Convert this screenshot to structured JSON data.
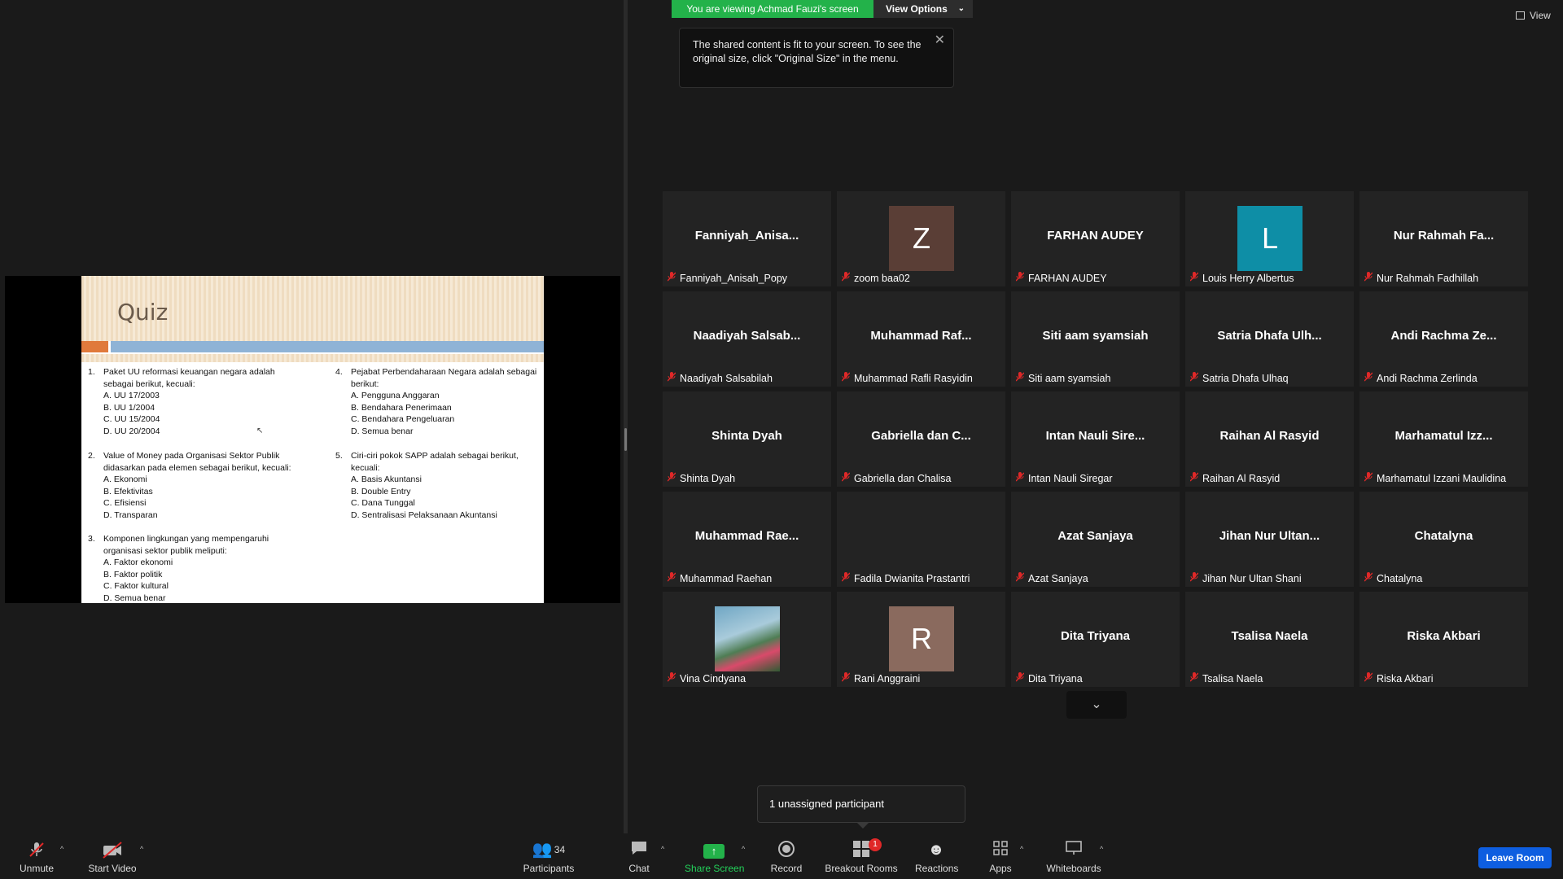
{
  "banner": {
    "viewing_text": "You are viewing Achmad Fauzi's screen",
    "view_options_label": "View Options"
  },
  "tooltip": {
    "text_line1": "The shared content is fit to your screen. To see the",
    "text_line2": "original size, click \"Original Size\" in the menu."
  },
  "top_right": {
    "view_label": "View"
  },
  "slide": {
    "title": "Quiz",
    "questions": [
      {
        "num": "1.",
        "lines": [
          "Paket UU reformasi keuangan negara adalah",
          "sebagai berikut, kecuali:",
          "A. UU 17/2003",
          "B. UU 1/2004",
          "C. UU 15/2004",
          "D. UU 20/2004"
        ]
      },
      {
        "num": "2.",
        "lines": [
          "Value of Money pada Organisasi Sektor Publik",
          "didasarkan pada elemen sebagai berikut, kecuali:",
          "A. Ekonomi",
          "B. Efektivitas",
          "C. Efisiensi",
          "D. Transparan"
        ]
      },
      {
        "num": "3.",
        "lines": [
          "Komponen lingkungan yang mempengaruhi",
          "organisasi sektor publik meliputi:",
          "A. Faktor ekonomi",
          "B. Faktor politik",
          "C. Faktor kultural",
          "D. Semua benar"
        ]
      },
      {
        "num": "4.",
        "lines": [
          "Pejabat Perbendaharaan Negara adalah sebagai",
          "berikut:",
          "A. Pengguna Anggaran",
          "B. Bendahara Penerimaan",
          "C. Bendahara Pengeluaran",
          "D. Semua benar"
        ]
      },
      {
        "num": "5.",
        "lines": [
          "Ciri-ciri pokok SAPP adalah sebagai berikut,",
          "kecuali:",
          "A. Basis Akuntansi",
          "B. Double Entry",
          "C. Dana Tunggal",
          "D. Sentralisasi Pelaksanaan Akuntansi"
        ]
      }
    ]
  },
  "participants": [
    {
      "display": "Fanniyah_Anisa...",
      "name": "Fanniyah_Anisah_Popy"
    },
    {
      "display": "",
      "name": "zoom baa02",
      "avatar_letter": "Z",
      "avatar_color": "#5a3e36"
    },
    {
      "display": "FARHAN AUDEY",
      "name": "FARHAN AUDEY"
    },
    {
      "display": "",
      "name": "Louis Herry Albertus",
      "avatar_letter": "L",
      "avatar_color": "#0e8ea6"
    },
    {
      "display": "Nur Rahmah Fa...",
      "name": "Nur Rahmah Fadhillah"
    },
    {
      "display": "Naadiyah  Salsab...",
      "name": "Naadiyah Salsabilah"
    },
    {
      "display": "Muhammad  Raf...",
      "name": "Muhammad Rafli Rasyidin"
    },
    {
      "display": "Siti aam syamsiah",
      "name": "Siti aam syamsiah"
    },
    {
      "display": "Satria  Dhafa  Ulh...",
      "name": "Satria Dhafa Ulhaq"
    },
    {
      "display": "Andi  Rachma  Ze...",
      "name": "Andi Rachma Zerlinda"
    },
    {
      "display": "Shinta Dyah",
      "name": "Shinta Dyah"
    },
    {
      "display": "Gabriella  dan  C...",
      "name": "Gabriella dan Chalisa"
    },
    {
      "display": "Intan  Nauli  Sire...",
      "name": "Intan Nauli Siregar"
    },
    {
      "display": "Raihan Al Rasyid",
      "name": "Raihan Al Rasyid"
    },
    {
      "display": "Marhamatul  Izz...",
      "name": "Marhamatul Izzani Maulidina"
    },
    {
      "display": "Muhammad  Rae...",
      "name": "Muhammad Raehan"
    },
    {
      "display": "",
      "name": "Fadila Dwianita Prastantri"
    },
    {
      "display": "Azat Sanjaya",
      "name": "Azat Sanjaya"
    },
    {
      "display": "Jihan  Nur  Ultan...",
      "name": "Jihan Nur Ultan Shani"
    },
    {
      "display": "Chatalyna",
      "name": "Chatalyna"
    },
    {
      "display": "",
      "name": "Vina Cindyana",
      "photo": true
    },
    {
      "display": "",
      "name": "Rani Anggraini",
      "avatar_letter": "R",
      "avatar_color": "#8a6a5e"
    },
    {
      "display": "Dita Triyana",
      "name": "Dita Triyana"
    },
    {
      "display": "Tsalisa Naela",
      "name": "Tsalisa Naela"
    },
    {
      "display": "Riska Akbari",
      "name": "Riska Akbari"
    }
  ],
  "notice": {
    "unassigned": "1 unassigned participant"
  },
  "toolbar": {
    "unmute": "Unmute",
    "start_video": "Start Video",
    "participants": "Participants",
    "participants_count": "34",
    "chat": "Chat",
    "share_screen": "Share Screen",
    "record": "Record",
    "breakout_rooms": "Breakout Rooms",
    "breakout_badge": "1",
    "reactions": "Reactions",
    "apps": "Apps",
    "whiteboards": "Whiteboards",
    "leave_room": "Leave Room"
  },
  "colors": {
    "accent_green": "#23b24a",
    "leave_blue": "#0e5ee0",
    "muted_red": "#e02828"
  }
}
